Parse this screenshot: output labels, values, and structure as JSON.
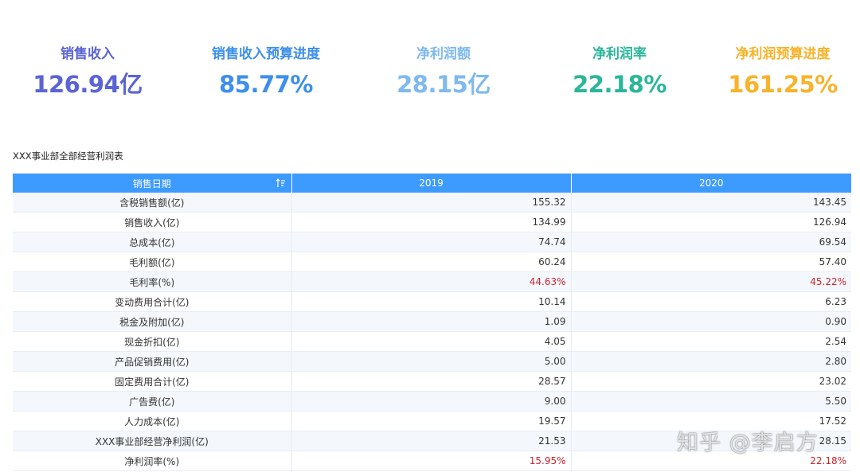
{
  "kpis": [
    {
      "label": "销售收入",
      "value": "126.94亿",
      "color": "#5b64d4"
    },
    {
      "label": "销售收入预算进度",
      "value": "85.77%",
      "color": "#3d8fea"
    },
    {
      "label": "净利润额",
      "value": "28.15亿",
      "color": "#7fb9ee"
    },
    {
      "label": "净利润率",
      "value": "22.18%",
      "color": "#2bb69a"
    },
    {
      "label": "净利润预算进度",
      "value": "161.25%",
      "color": "#f7b32b"
    }
  ],
  "table": {
    "title": "XXX事业部全部经营利润表",
    "headers": [
      "销售日期",
      "2019",
      "2020"
    ],
    "sort_icon": "sort-icon",
    "rows": [
      {
        "name": "含税销售额(亿)",
        "v2019": "155.32",
        "v2020": "143.45",
        "highlight": false
      },
      {
        "name": "销售收入(亿)",
        "v2019": "134.99",
        "v2020": "126.94",
        "highlight": false
      },
      {
        "name": "总成本(亿)",
        "v2019": "74.74",
        "v2020": "69.54",
        "highlight": false
      },
      {
        "name": "毛利额(亿)",
        "v2019": "60.24",
        "v2020": "57.40",
        "highlight": false
      },
      {
        "name": "毛利率(%)",
        "v2019": "44.63%",
        "v2020": "45.22%",
        "highlight": true
      },
      {
        "name": "变动费用合计(亿)",
        "v2019": "10.14",
        "v2020": "6.23",
        "highlight": false
      },
      {
        "name": "税金及附加(亿)",
        "v2019": "1.09",
        "v2020": "0.90",
        "highlight": false
      },
      {
        "name": "现金折扣(亿)",
        "v2019": "4.05",
        "v2020": "2.54",
        "highlight": false
      },
      {
        "name": "产品促销费用(亿)",
        "v2019": "5.00",
        "v2020": "2.80",
        "highlight": false
      },
      {
        "name": "固定费用合计(亿)",
        "v2019": "28.57",
        "v2020": "23.02",
        "highlight": false
      },
      {
        "name": "广告费(亿)",
        "v2019": "9.00",
        "v2020": "5.50",
        "highlight": false
      },
      {
        "name": "人力成本(亿)",
        "v2019": "19.57",
        "v2020": "17.52",
        "highlight": false
      },
      {
        "name": "XXX事业部经营净利润(亿)",
        "v2019": "21.53",
        "v2020": "28.15",
        "highlight": false
      },
      {
        "name": "净利润率(%)",
        "v2019": "15.95%",
        "v2020": "22.18%",
        "highlight": true
      }
    ]
  },
  "highlight_color": "#d0232a",
  "header_color": "#3d9bff",
  "watermark": "知乎 @李启方"
}
